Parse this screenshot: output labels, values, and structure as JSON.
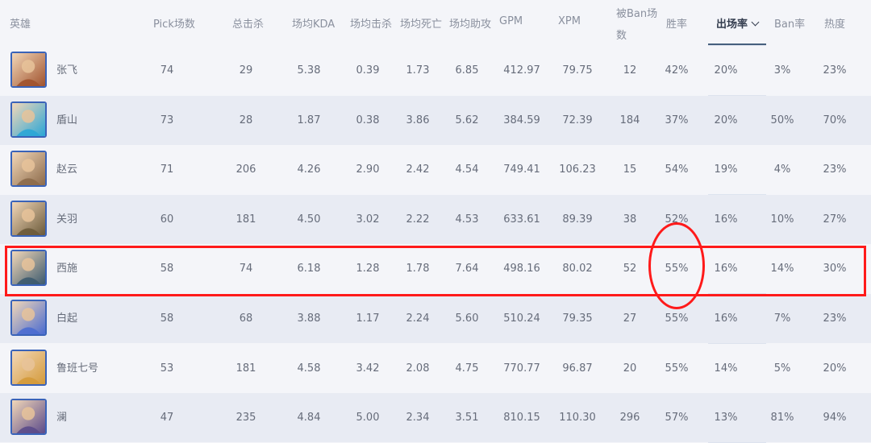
{
  "columns": [
    {
      "key": "hero",
      "label": "英雄"
    },
    {
      "key": "pick",
      "label": "Pick场数"
    },
    {
      "key": "kills",
      "label": "总击杀"
    },
    {
      "key": "kda",
      "label": "场均KDA"
    },
    {
      "key": "avg_kills",
      "label": "场均击杀"
    },
    {
      "key": "avg_deaths",
      "label": "场均死亡"
    },
    {
      "key": "avg_assists",
      "label": "场均助攻"
    },
    {
      "key": "gpm",
      "label": "GPM"
    },
    {
      "key": "xpm",
      "label": "XPM"
    },
    {
      "key": "banned_line1",
      "label": "被Ban场"
    },
    {
      "key": "banned_line2",
      "label": "数"
    },
    {
      "key": "winrate",
      "label": "胜率"
    },
    {
      "key": "appear",
      "label": "出场率"
    },
    {
      "key": "banrate",
      "label": "Ban率"
    },
    {
      "key": "heat",
      "label": "热度"
    }
  ],
  "sorted_column": "出场率",
  "rows": [
    {
      "hero": "张飞",
      "icon": "zhangfei-avatar-icon",
      "color": "#a0522d",
      "pick": "74",
      "kills": "29",
      "kda": "5.38",
      "avg_kills": "0.39",
      "avg_deaths": "1.73",
      "avg_assists": "6.85",
      "gpm": "412.97",
      "xpm": "79.75",
      "banned": "12",
      "winrate": "42%",
      "appear": "20%",
      "banrate": "3%",
      "heat": "23%"
    },
    {
      "hero": "盾山",
      "icon": "dunshan-avatar-icon",
      "color": "#2aa6d6",
      "pick": "73",
      "kills": "28",
      "kda": "1.87",
      "avg_kills": "0.38",
      "avg_deaths": "3.86",
      "avg_assists": "5.62",
      "gpm": "384.59",
      "xpm": "72.39",
      "banned": "184",
      "winrate": "37%",
      "appear": "20%",
      "banrate": "50%",
      "heat": "70%"
    },
    {
      "hero": "赵云",
      "icon": "zhaoyun-avatar-icon",
      "color": "#8c6a4a",
      "pick": "71",
      "kills": "206",
      "kda": "4.26",
      "avg_kills": "2.90",
      "avg_deaths": "2.42",
      "avg_assists": "4.54",
      "gpm": "749.41",
      "xpm": "106.23",
      "banned": "15",
      "winrate": "54%",
      "appear": "19%",
      "banrate": "4%",
      "heat": "23%"
    },
    {
      "hero": "关羽",
      "icon": "guanyu-avatar-icon",
      "color": "#6b5a3a",
      "pick": "60",
      "kills": "181",
      "kda": "4.50",
      "avg_kills": "3.02",
      "avg_deaths": "2.22",
      "avg_assists": "4.53",
      "gpm": "633.61",
      "xpm": "89.39",
      "banned": "38",
      "winrate": "52%",
      "appear": "16%",
      "banrate": "10%",
      "heat": "27%"
    },
    {
      "hero": "西施",
      "icon": "xishi-avatar-icon",
      "color": "#3c5a6e",
      "pick": "58",
      "kills": "74",
      "kda": "6.18",
      "avg_kills": "1.28",
      "avg_deaths": "1.78",
      "avg_assists": "7.64",
      "gpm": "498.16",
      "xpm": "80.02",
      "banned": "52",
      "winrate": "55%",
      "appear": "16%",
      "banrate": "14%",
      "heat": "30%"
    },
    {
      "hero": "白起",
      "icon": "baiqi-avatar-icon",
      "color": "#4a6bd0",
      "pick": "58",
      "kills": "68",
      "kda": "3.88",
      "avg_kills": "1.17",
      "avg_deaths": "2.24",
      "avg_assists": "5.60",
      "gpm": "510.24",
      "xpm": "79.35",
      "banned": "27",
      "winrate": "55%",
      "appear": "16%",
      "banrate": "7%",
      "heat": "23%"
    },
    {
      "hero": "鲁班七号",
      "icon": "luban-avatar-icon",
      "color": "#d49a3a",
      "pick": "53",
      "kills": "181",
      "kda": "4.58",
      "avg_kills": "3.42",
      "avg_deaths": "2.08",
      "avg_assists": "4.75",
      "gpm": "770.77",
      "xpm": "96.87",
      "banned": "20",
      "winrate": "55%",
      "appear": "14%",
      "banrate": "5%",
      "heat": "20%"
    },
    {
      "hero": "澜",
      "icon": "lan-avatar-icon",
      "color": "#5a4a8a",
      "pick": "47",
      "kills": "235",
      "kda": "4.84",
      "avg_kills": "5.00",
      "avg_deaths": "2.34",
      "avg_assists": "3.51",
      "gpm": "810.15",
      "xpm": "110.30",
      "banned": "296",
      "winrate": "57%",
      "appear": "13%",
      "banrate": "81%",
      "heat": "94%"
    }
  ],
  "annotations": {
    "highlight_color": "#ff1a1a",
    "highlighted_row": "西施",
    "circled_column": "胜率"
  }
}
